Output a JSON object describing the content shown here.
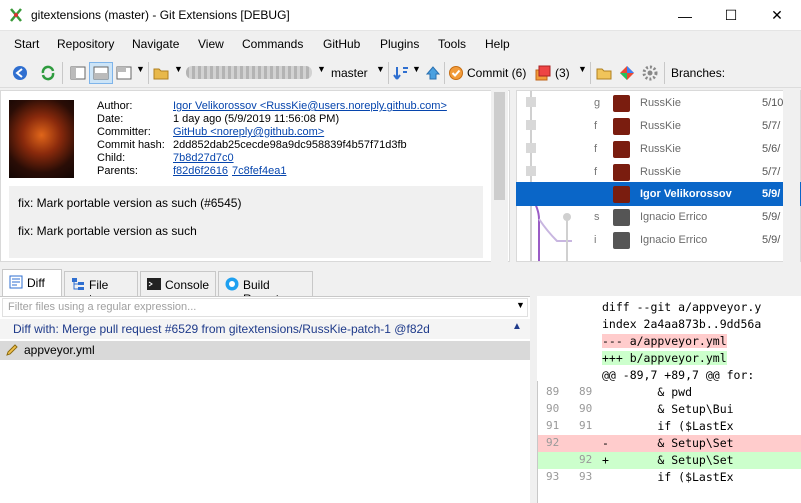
{
  "window": {
    "title": "gitextensions (master) - Git Extensions [DEBUG]",
    "minimize": "—",
    "maximize": "☐",
    "close": "✕"
  },
  "menu": [
    "Start",
    "Repository",
    "Navigate",
    "View",
    "Commands",
    "GitHub",
    "Plugins",
    "Tools",
    "Help"
  ],
  "toolbar": {
    "branch": "master",
    "commit_label": "Commit (6)",
    "stash_count": "(3)",
    "branches_label": "Branches:"
  },
  "commit_info": {
    "labels": [
      "Author:",
      "Date:",
      "Committer:",
      "Commit hash:",
      "Child:",
      "Parents:"
    ],
    "author": "Igor Velikorossov <RussKie@users.noreply.github.com>",
    "date": "1 day ago (5/9/2019 11:56:08 PM)",
    "committer": "GitHub <noreply@github.com>",
    "hash": "2dd852dab25cecde98a9dc958839f4b57f71d3fb",
    "child": "7b8d27d7c0",
    "parent1": "f82d6f2616",
    "parent2": "7c8fef4ea1",
    "message_subject": "fix: Mark portable version as such (#6545)",
    "message_body": "fix: Mark portable version as such"
  },
  "revisions": [
    {
      "sha": "g",
      "author": "RussKie",
      "date": "5/10"
    },
    {
      "sha": "f",
      "author": "RussKie",
      "date": "5/7/"
    },
    {
      "sha": "f",
      "author": "RussKie",
      "date": "5/6/"
    },
    {
      "sha": "f",
      "author": "RussKie",
      "date": "5/7/"
    },
    {
      "sha": "r",
      "author": "Igor Velikorossov",
      "date": "5/9/"
    },
    {
      "sha": "s",
      "author": "Ignacio Errico",
      "date": "5/9/"
    },
    {
      "sha": "i",
      "author": "Ignacio Errico",
      "date": "5/9/"
    }
  ],
  "tabs": [
    "Diff",
    "File tree",
    "Console",
    "Build Report"
  ],
  "diff": {
    "filter_placeholder": "Filter files using a regular expression...",
    "diff_with": "Diff with: Merge pull request #6529 from gitextensions/RussKie-patch-1 @f82d",
    "file": "appveyor.yml",
    "lines": [
      {
        "l": "",
        "r": "",
        "text": "diff --git a/appveyor.y",
        "kind": "hdr"
      },
      {
        "l": "",
        "r": "",
        "text": "index 2a4aa873b..9dd56a",
        "kind": "hdr"
      },
      {
        "l": "",
        "r": "",
        "text": "--- a/appveyor.yml",
        "kind": "hdrdel"
      },
      {
        "l": "",
        "r": "",
        "text": "+++ b/appveyor.yml",
        "kind": "hdradd"
      },
      {
        "l": "",
        "r": "",
        "text": "@@ -89,7 +89,7 @@ for:",
        "kind": "hunk"
      },
      {
        "l": "89",
        "r": "89",
        "text": "        & pwd",
        "kind": "ctx"
      },
      {
        "l": "90",
        "r": "90",
        "text": "        & Setup\\Bui",
        "kind": "ctx"
      },
      {
        "l": "91",
        "r": "91",
        "text": "        if ($LastEx",
        "kind": "ctx"
      },
      {
        "l": "92",
        "r": "",
        "text": "-       & Setup\\Set",
        "kind": "del"
      },
      {
        "l": "",
        "r": "92",
        "text": "+       & Setup\\Set",
        "kind": "add"
      },
      {
        "l": "93",
        "r": "93",
        "text": "        if ($LastEx",
        "kind": "ctx"
      }
    ]
  },
  "colors": {
    "selection": "#0a66c8",
    "link": "#0645ad",
    "deleted": "#ffcccc",
    "added": "#ccffcc"
  }
}
